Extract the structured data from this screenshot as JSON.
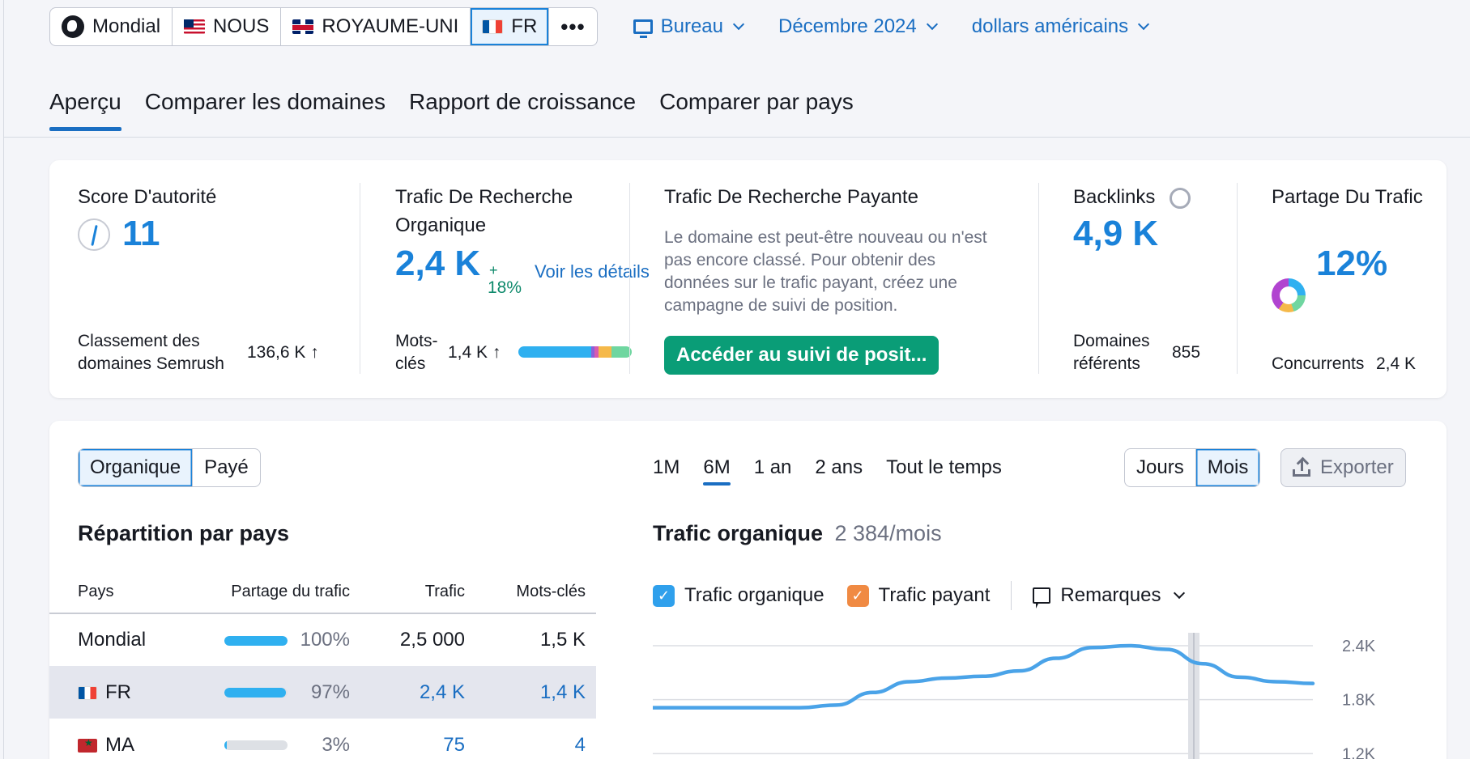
{
  "database_selector": {
    "items": [
      {
        "label": "Mondial",
        "icon": "globe-icon"
      },
      {
        "label": "NOUS",
        "icon": "flag-us-icon"
      },
      {
        "label": "ROYAUME-UNI",
        "icon": "flag-uk-icon"
      },
      {
        "label": "FR",
        "icon": "flag-fr-icon",
        "selected": true
      }
    ],
    "more": "•••"
  },
  "filters": {
    "device": "Bureau",
    "date": "Décembre 2024",
    "currency": "dollars américains"
  },
  "tabs": [
    "Aperçu",
    "Comparer les domaines",
    "Rapport de croissance",
    "Comparer par pays"
  ],
  "metrics": {
    "authority": {
      "title": "Score D'autorité",
      "value": "11",
      "rank_label": "Classement des domaines Semrush",
      "rank_value": "136,6 K ↑"
    },
    "organic": {
      "title": "Trafic De Recherche Organique",
      "value": "2,4 K",
      "change_sign": "+",
      "change": "18%",
      "details_link": "Voir les détails",
      "keywords_label": "Mots-clés",
      "keywords_value": "1,4 K ↑"
    },
    "paid": {
      "title": "Trafic De Recherche Payante",
      "description": "Le domaine est peut-être nouveau ou n'est pas encore classé. Pour obtenir des données sur le trafic payant, créez une campagne de suivi de position.",
      "cta": "Accéder au suivi de posit..."
    },
    "backlinks": {
      "title": "Backlinks",
      "value": "4,9 K",
      "ref_label": "Domaines référents",
      "ref_value": "855"
    },
    "share": {
      "title": "Partage Du Trafic",
      "value": "12%",
      "competitors_label": "Concurrents",
      "competitors_value": "2,4 K"
    }
  },
  "chart_controls": {
    "type_toggle": [
      "Organique",
      "Payé"
    ],
    "periods": [
      "1M",
      "6M",
      "1 an",
      "2 ans",
      "Tout le temps"
    ],
    "granularity": [
      "Jours",
      "Mois"
    ],
    "export": "Exporter"
  },
  "country_table": {
    "title": "Répartition par pays",
    "headers": [
      "Pays",
      "Partage du trafic",
      "Trafic",
      "Mots-clés"
    ],
    "rows": [
      {
        "country": "Mondial",
        "share": "100%",
        "share_value": 1.0,
        "traffic": "2,5 000",
        "keywords": "1,5 K"
      },
      {
        "country": "FR",
        "share": "97%",
        "share_value": 0.97,
        "traffic": "2,4 K",
        "keywords": "1,4 K"
      },
      {
        "country": "MA",
        "share": "3%",
        "share_value": 0.03,
        "traffic": "75",
        "keywords": "4"
      }
    ]
  },
  "traffic_chart": {
    "title": "Trafic organique",
    "subtitle": "2 384/mois",
    "legend": [
      "Trafic organique",
      "Trafic payant"
    ],
    "notes": "Remarques"
  },
  "chart_data": {
    "type": "line",
    "yticks": [
      "2.4K",
      "1.8K",
      "1.2K"
    ],
    "ylim": [
      600,
      2400
    ],
    "series": [
      {
        "name": "Trafic organique",
        "color": "#4aa3e8",
        "values": [
          1710,
          1710,
          1710,
          1710,
          1710,
          1740,
          1880,
          2000,
          2040,
          2060,
          2120,
          2260,
          2380,
          2400,
          2360,
          2200,
          2050,
          2000,
          1980
        ]
      }
    ]
  },
  "colors": {
    "accent": "#1a82d9",
    "cta": "#0a9d77",
    "positive": "#0f8a6c",
    "organic_check": "#2fa0ec",
    "paid_check": "#f08a43"
  }
}
